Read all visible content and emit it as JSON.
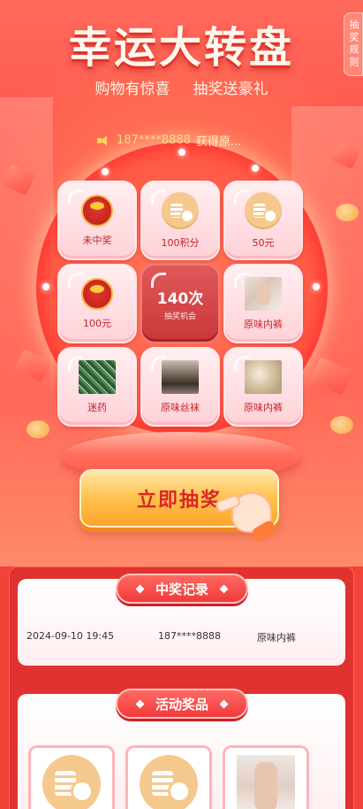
{
  "header": {
    "title": "幸运大转盘",
    "subtitle_left": "购物有惊喜",
    "subtitle_right": "抽奖送豪礼",
    "rules_label": "抽奖规则"
  },
  "notice": {
    "phone": "187****8888",
    "text": "获得原..."
  },
  "grid": {
    "cells": [
      {
        "label": "未中奖",
        "icon": "red-bag-icon"
      },
      {
        "label": "100积分",
        "icon": "coin-icon"
      },
      {
        "label": "50元",
        "icon": "coin-icon"
      },
      {
        "label": "100元",
        "icon": "red-bag-icon"
      },
      {
        "label": "原味内裤",
        "icon": "product-photo"
      },
      {
        "label": "迷药",
        "icon": "product-photo"
      },
      {
        "label": "原味丝袜",
        "icon": "product-photo"
      },
      {
        "label": "原味内裤",
        "icon": "product-photo"
      }
    ],
    "center": {
      "count": "140次",
      "sub": "抽奖机会"
    }
  },
  "draw_button": {
    "label": "立即抽奖"
  },
  "records": {
    "title": "中奖记录",
    "rows": [
      {
        "time": "2024-09-10 19:45",
        "phone": "187****8888",
        "prize": "原味内裤"
      }
    ]
  },
  "prizes": {
    "title": "活动奖品"
  },
  "colors": {
    "primary_red": "#f3423a",
    "button_gold": "#ffc14d",
    "label_red": "#c2242a"
  }
}
